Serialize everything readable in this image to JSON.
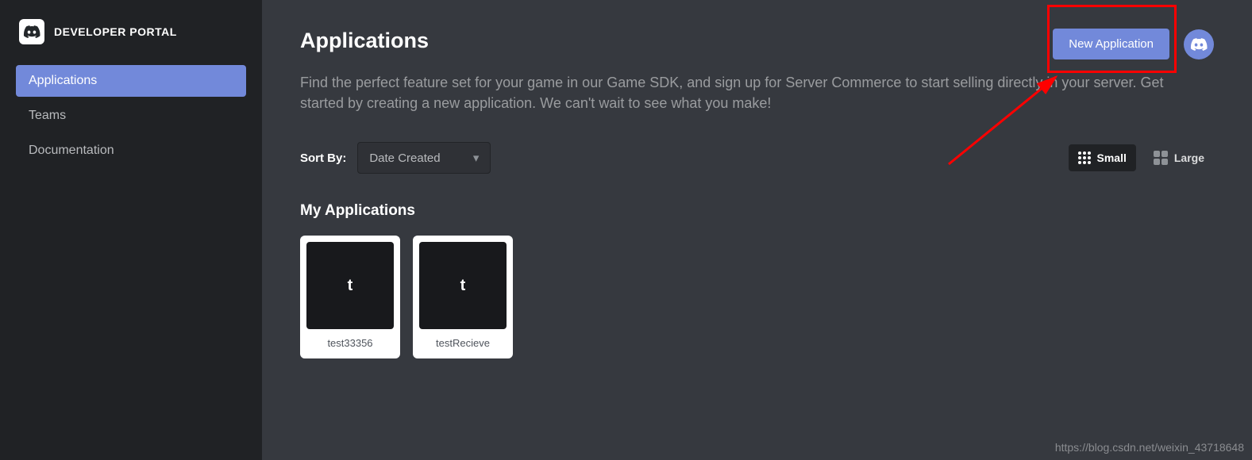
{
  "brand": {
    "title": "DEVELOPER PORTAL"
  },
  "sidebar": {
    "items": [
      {
        "label": "Applications",
        "active": true
      },
      {
        "label": "Teams",
        "active": false
      },
      {
        "label": "Documentation",
        "active": false
      }
    ]
  },
  "header": {
    "title": "Applications",
    "new_button_label": "New Application"
  },
  "description": "Find the perfect feature set for your game in our Game SDK, and sign up for Server Commerce to start selling directly in your server. Get started by creating a new application. We can't wait to see what you make!",
  "sort": {
    "label": "Sort By:",
    "selected": "Date Created"
  },
  "view_toggle": {
    "small_label": "Small",
    "large_label": "Large",
    "selected": "small"
  },
  "section_title": "My Applications",
  "apps": [
    {
      "letter": "t",
      "name": "test33356"
    },
    {
      "letter": "t",
      "name": "testRecieve"
    }
  ],
  "watermark": "https://blog.csdn.net/weixin_43718648"
}
